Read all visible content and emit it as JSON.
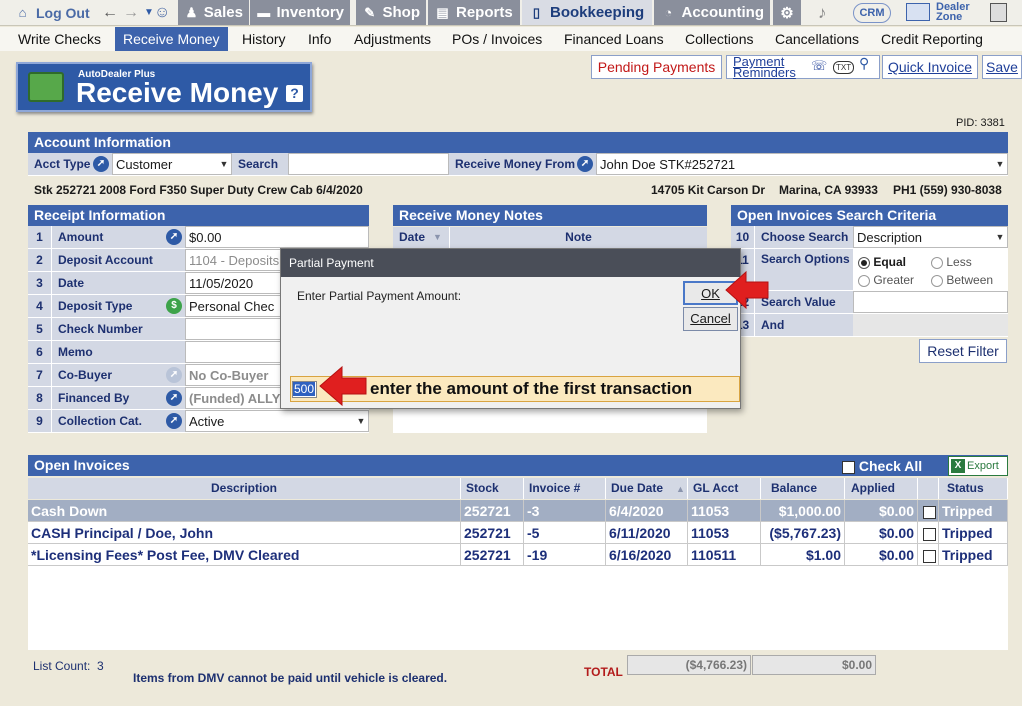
{
  "nav": {
    "logout": "Log Out",
    "sales": "Sales",
    "inventory": "Inventory",
    "shop": "Shop",
    "reports": "Reports",
    "bookkeeping": "Bookkeeping",
    "accounting": "Accounting",
    "crm": "CRM",
    "dealer_zone_1": "Dealer",
    "dealer_zone_2": "Zone"
  },
  "subnav": [
    "Write Checks",
    "Receive Money",
    "History",
    "Info",
    "Adjustments",
    "POs / Invoices",
    "Financed Loans",
    "Collections",
    "Cancellations",
    "Credit Reporting"
  ],
  "header": {
    "brand": "AutoDealer Plus",
    "title": "Receive Money",
    "help": "?",
    "pid": "PID: 3381"
  },
  "buttons": {
    "pending": "Pending Payments",
    "reminders_1": "Payment",
    "reminders_2": "Reminders",
    "txt": "TXT",
    "quick_invoice": "Quick Invoice",
    "save": "Save"
  },
  "account": {
    "title": "Account Information",
    "acct_type_label": "Acct Type",
    "acct_type_value": "Customer",
    "search_label": "Search",
    "search_value": "",
    "receive_from_label": "Receive Money From",
    "receive_from_value": "John Doe STK#252721"
  },
  "vehicle": {
    "desc": "Stk 252721 2008 Ford F350 Super Duty Crew Cab 6/4/2020",
    "address": "14705 Kit Carson Dr",
    "city": "Marina, CA 93933",
    "phone": "PH1 (559) 930-8038"
  },
  "receipt": {
    "title": "Receipt Information",
    "rows": [
      {
        "n": "1",
        "label": "Amount",
        "value": "$0.00"
      },
      {
        "n": "2",
        "label": "Deposit Account",
        "value": "1104 - Deposits"
      },
      {
        "n": "3",
        "label": "Date",
        "value": "11/05/2020"
      },
      {
        "n": "4",
        "label": "Deposit Type",
        "value": "Personal Chec"
      },
      {
        "n": "5",
        "label": "Check Number",
        "value": ""
      },
      {
        "n": "6",
        "label": "Memo",
        "value": ""
      },
      {
        "n": "7",
        "label": "Co-Buyer",
        "value": "No Co-Buyer"
      },
      {
        "n": "8",
        "label": "Financed By",
        "value": "(Funded) ALLY"
      },
      {
        "n": "9",
        "label": "Collection Cat.",
        "value": "Active"
      }
    ]
  },
  "notes": {
    "title": "Receive Money Notes",
    "col_date": "Date",
    "col_note": "Note"
  },
  "search": {
    "title": "Open Invoices Search Criteria",
    "choose_n": "10",
    "choose_label": "Choose Search",
    "choose_value": "Description",
    "options_n": "11",
    "options_label": "Search Options",
    "opt_equal": "Equal",
    "opt_less": "Less",
    "opt_greater": "Greater",
    "opt_between": "Between",
    "value_n": "12",
    "value_label": "Search Value",
    "and_n": "13",
    "and_label": "And",
    "reset": "Reset Filter"
  },
  "invoices": {
    "title": "Open Invoices",
    "check_all": "Check All",
    "export": "Export",
    "columns": [
      "Description",
      "Stock",
      "Invoice #",
      "Due Date",
      "GL Acct",
      "Balance",
      "Applied",
      "",
      "Status"
    ],
    "rows": [
      {
        "description": "Cash Down",
        "stock": "252721",
        "invoice": "-3",
        "due": "6/4/2020",
        "gl": "11053",
        "balance": "$1,000.00",
        "applied": "$0.00",
        "status": "Tripped"
      },
      {
        "description": "CASH Principal / Doe, John",
        "stock": "252721",
        "invoice": "-5",
        "due": "6/11/2020",
        "gl": "11053",
        "balance": "($5,767.23)",
        "applied": "$0.00",
        "status": "Tripped"
      },
      {
        "description": "*Licensing Fees* Post Fee, DMV Cleared",
        "stock": "252721",
        "invoice": "-19",
        "due": "6/16/2020",
        "gl": "110511",
        "balance": "$1.00",
        "applied": "$0.00",
        "status": "Tripped"
      }
    ]
  },
  "footer": {
    "list_count_label": "List Count:",
    "list_count": "3",
    "dmv_note": "Items from DMV cannot be paid until vehicle is cleared.",
    "total_label": "TOTAL",
    "total_balance": "($4,766.23)",
    "total_applied": "$0.00"
  },
  "dialog": {
    "title": "Partial Payment",
    "prompt": "Enter Partial Payment Amount:",
    "ok": "OK",
    "cancel": "Cancel",
    "input_value": "500",
    "annotation": "enter the amount of the first transaction"
  }
}
